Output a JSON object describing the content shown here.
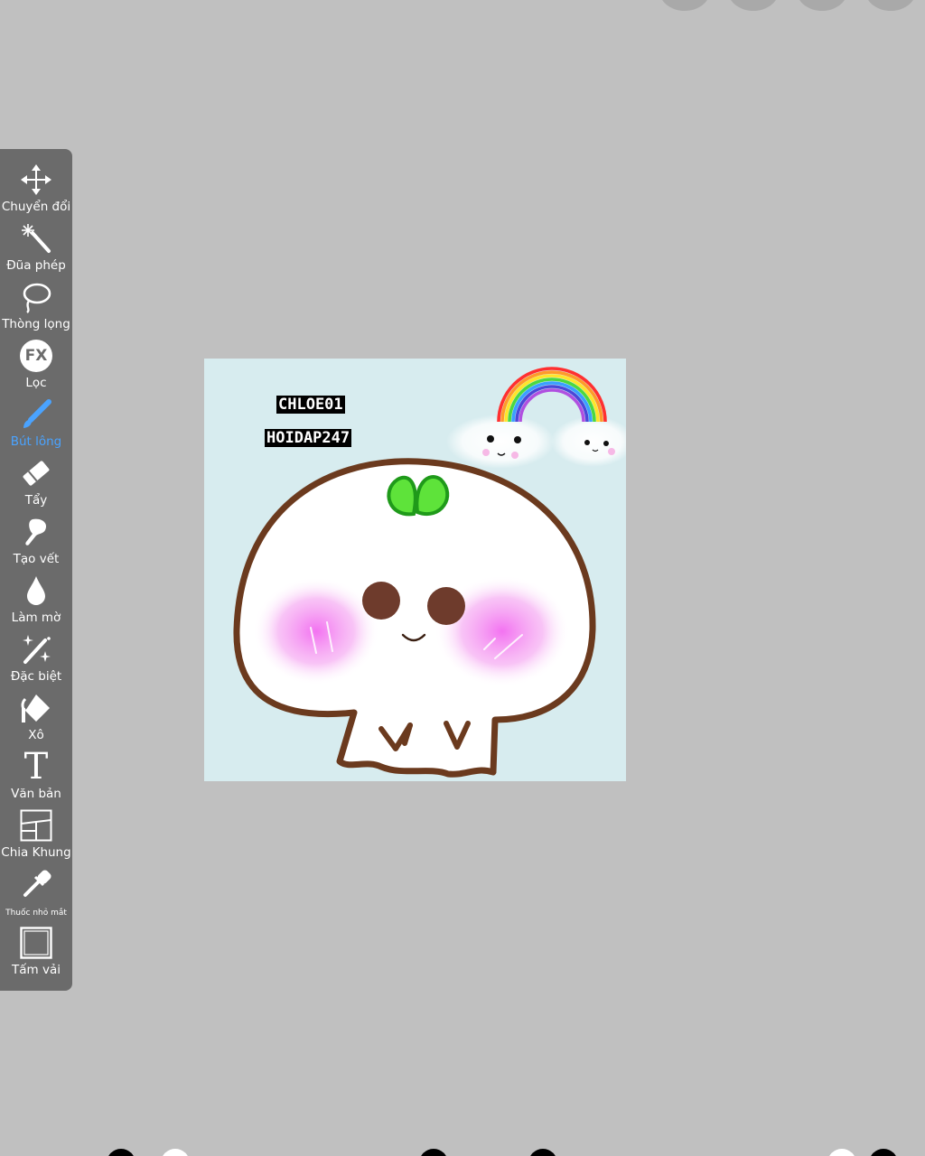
{
  "toolbar": {
    "items": [
      {
        "label": "Chuyển đổi",
        "icon": "move-icon"
      },
      {
        "label": "Đũa phép",
        "icon": "magic-wand-icon"
      },
      {
        "label": "Thòng lọng",
        "icon": "lasso-icon"
      },
      {
        "label": "Lọc",
        "icon": "fx-filter-icon"
      },
      {
        "label": "Bút lông",
        "icon": "brush-icon",
        "active": true
      },
      {
        "label": "Tẩy",
        "icon": "eraser-icon"
      },
      {
        "label": "Tạo vết",
        "icon": "smudge-icon"
      },
      {
        "label": "Làm mờ",
        "icon": "blur-drop-icon"
      },
      {
        "label": "Đặc biệt",
        "icon": "special-sparkle-icon"
      },
      {
        "label": "Xô",
        "icon": "bucket-icon"
      },
      {
        "label": "Văn bản",
        "icon": "text-icon"
      },
      {
        "label": "Chia Khung",
        "icon": "frame-divider-icon"
      },
      {
        "label": "Thuốc nhỏ mắt",
        "icon": "eyedropper-icon"
      },
      {
        "label": "Tấm vải",
        "icon": "canvas-icon"
      }
    ],
    "fx_glyph": "FX",
    "text_glyph": "T"
  },
  "canvas": {
    "watermark_line1": "CHLOE01",
    "watermark_line2": "HOIDAP247"
  },
  "colors": {
    "panel": "#6b6b6b",
    "active": "#4aa3ff",
    "background": "#c0c0c0",
    "canvas_bg": "#d7ecef",
    "outline": "#6b3a1e",
    "blush": "#f49cf0",
    "leaf": "#5ee33a"
  }
}
